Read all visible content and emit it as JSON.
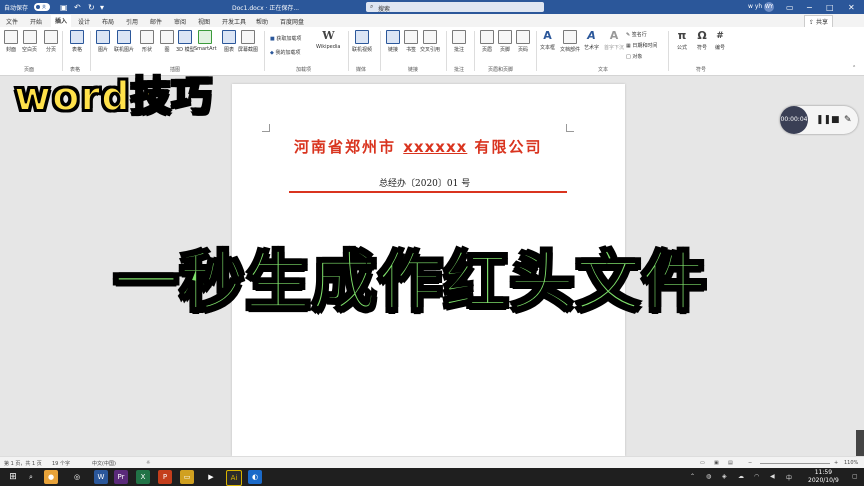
{
  "titlebar": {
    "autosave": "自动保存",
    "autosave_state": "关",
    "doc_name": "Doc1.docx · 正在保存...",
    "search_placeholder": "搜索",
    "user": "w yh",
    "avatar_initials": "WY"
  },
  "tabs": [
    "文件",
    "开始",
    "插入",
    "设计",
    "布局",
    "引用",
    "邮件",
    "审阅",
    "视图",
    "开发工具",
    "帮助",
    "百度网盘"
  ],
  "share_label": "共享",
  "ribbon": {
    "pages": [
      "封面",
      "空白页",
      "分页"
    ],
    "table": "表格",
    "illustrations": [
      "图片",
      "联机图片",
      "形状",
      "图",
      "3D 模型",
      "SmartArt",
      "图表",
      "屏幕截图"
    ],
    "addins": [
      "获取加载项",
      "我的加载项"
    ],
    "wikipedia": "Wikipedia",
    "media": "联机视频",
    "links": [
      "链接",
      "书签",
      "交叉引用"
    ],
    "comment": "批注",
    "header_footer": [
      "页眉",
      "页脚",
      "页码"
    ],
    "text_items": [
      "文本框",
      "文档部件",
      "艺术字",
      "首字下沉"
    ],
    "text_small": [
      "签名行",
      "日期和时间",
      "对象"
    ],
    "symbols": [
      "公式",
      "符号",
      "编号"
    ],
    "groups": [
      "页面",
      "表格",
      "插图",
      "加载项",
      "媒体",
      "链接",
      "批注",
      "页眉和页脚",
      "文本",
      "符号"
    ]
  },
  "document": {
    "title_prefix": "河南省郑州市",
    "title_placeholder": "xxxxxx",
    "title_suffix": "有限公司",
    "doc_number": "总经办〔2020〕01 号",
    "accent_color": "#d9341f"
  },
  "captions": {
    "top": "word技巧",
    "main": "一秒生成作红头文件"
  },
  "recorder": {
    "time": "00:00:04"
  },
  "statusbar": {
    "page": "第 1 页，共 1 页",
    "words": "19 个字",
    "language": "中文(中国)",
    "zoom": "110%"
  },
  "taskbar": {
    "time": "11:59",
    "date": "2020/10/9"
  }
}
